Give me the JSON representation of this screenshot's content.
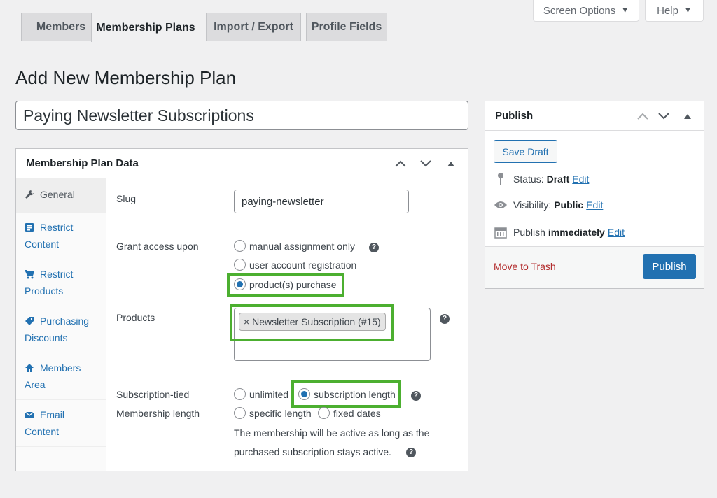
{
  "screen_meta": {
    "screen_options_label": "Screen Options",
    "help_label": "Help"
  },
  "nav_tabs": [
    {
      "label": "Members",
      "active": false
    },
    {
      "label": "Membership Plans",
      "active": true
    },
    {
      "label": "Import / Export",
      "active": false
    },
    {
      "label": "Profile Fields",
      "active": false
    }
  ],
  "page_title": "Add New Membership Plan",
  "plan_title_value": "Paying Newsletter Subscriptions",
  "plan_data": {
    "title": "Membership Plan Data",
    "sidebar": [
      {
        "label": "General",
        "icon": "wrench-icon",
        "active": true
      },
      {
        "label": "Restrict Content",
        "icon": "document-icon",
        "active": false
      },
      {
        "label": "Restrict Products",
        "icon": "cart-icon",
        "active": false
      },
      {
        "label": "Purchasing Discounts",
        "icon": "tag-icon",
        "active": false
      },
      {
        "label": "Members Area",
        "icon": "home-icon",
        "active": false
      },
      {
        "label": "Email Content",
        "icon": "envelope-icon",
        "active": false
      }
    ],
    "slug": {
      "label": "Slug",
      "value": "paying-newsletter"
    },
    "grant_access": {
      "label": "Grant access upon",
      "options": [
        {
          "label": "manual assignment only",
          "checked": false
        },
        {
          "label": "user account registration",
          "checked": false
        },
        {
          "label": "product(s) purchase",
          "checked": true
        }
      ]
    },
    "products": {
      "label": "Products",
      "selected": [
        {
          "label": "Newsletter Subscription (#15)",
          "remove": "×"
        }
      ]
    },
    "membership_length": {
      "label_line1": "Subscription-tied",
      "label_line2": "Membership length",
      "options": [
        {
          "label": "unlimited",
          "checked": false
        },
        {
          "label": "subscription length",
          "checked": true
        },
        {
          "label": "specific length",
          "checked": false
        },
        {
          "label": "fixed dates",
          "checked": false
        }
      ],
      "description_line1": "The membership will be active as long as the",
      "description_line2": "purchased subscription stays active."
    },
    "help_glyph": "?"
  },
  "publish": {
    "title": "Publish",
    "save_draft_label": "Save Draft",
    "status_label": "Status:",
    "status_value": "Draft",
    "visibility_label": "Visibility:",
    "visibility_value": "Public",
    "publish_label": "Publish",
    "publish_value": "immediately",
    "edit_label": "Edit",
    "move_to_trash_label": "Move to Trash",
    "publish_button_label": "Publish"
  },
  "colors": {
    "accent": "#2271b1",
    "highlight": "#4caf30",
    "trash": "#b32d2e"
  }
}
